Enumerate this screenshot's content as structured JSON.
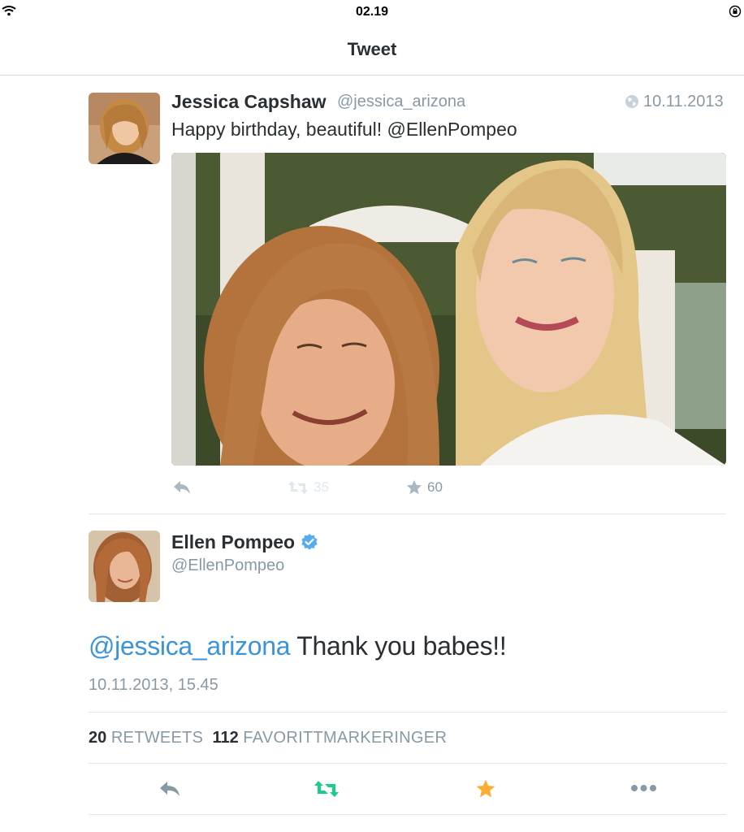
{
  "status_bar": {
    "time": "02.19"
  },
  "nav": {
    "title": "Tweet"
  },
  "quoted_tweet": {
    "name": "Jessica Capshaw",
    "handle": "@jessica_arizona",
    "date": "10.11.2013",
    "text": "Happy birthday, beautiful! @EllenPompeo",
    "retweet_count": "35",
    "favorite_count": "60"
  },
  "tweet": {
    "name": "Ellen Pompeo",
    "handle": "@EllenPompeo",
    "mention": "@jessica_arizona",
    "text": " Thank you babes!!",
    "timestamp": "10.11.2013, 15.45",
    "retweets_count": "20",
    "retweets_label": "RETWEETS",
    "favorites_count": "112",
    "favorites_label": "FAVORITTMARKERINGER"
  },
  "colors": {
    "link": "#3b94d9",
    "retweet_active": "#19cf86",
    "favorite_active": "#ffac33",
    "muted": "#8899a6",
    "verified": "#55acee"
  }
}
